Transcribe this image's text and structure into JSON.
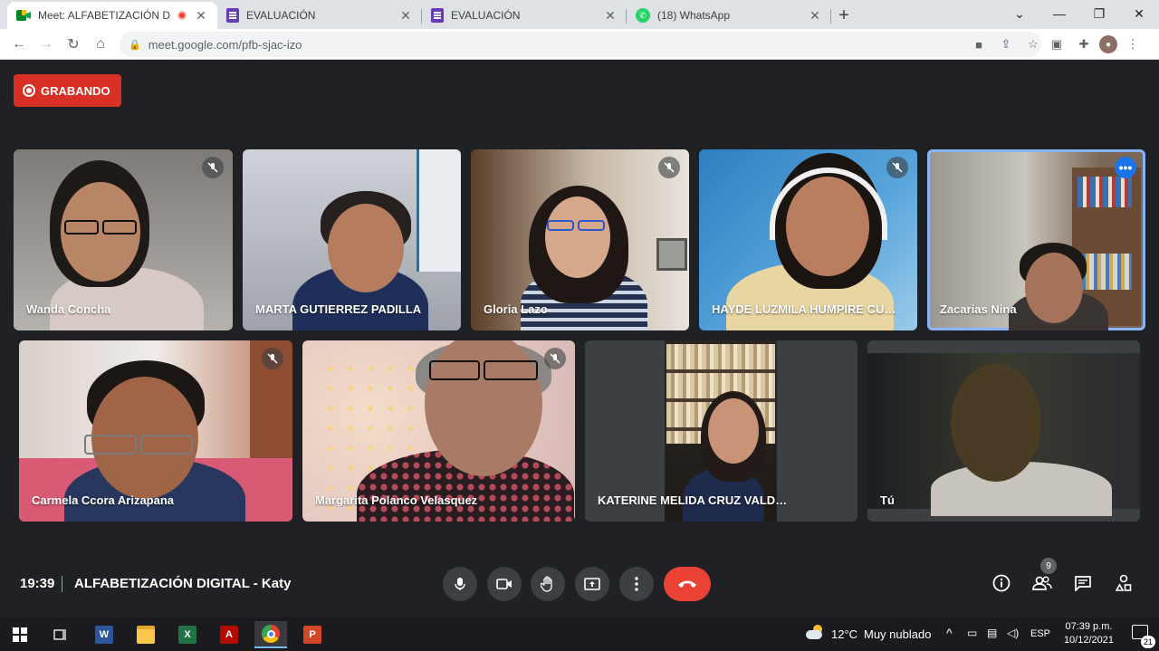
{
  "browser": {
    "tabs": [
      {
        "title": "Meet: ALFABETIZACIÓN DIGITAL",
        "icon": "google-meet-icon",
        "recording": true,
        "active": true
      },
      {
        "title": "EVALUACIÓN",
        "icon": "google-forms-icon",
        "active": false
      },
      {
        "title": "EVALUACIÓN",
        "icon": "google-forms-icon",
        "active": false
      },
      {
        "title": "(18) WhatsApp",
        "icon": "whatsapp-icon",
        "active": false
      }
    ],
    "url": "meet.google.com/pfb-sjac-izo",
    "new_tab": "+",
    "window_controls": [
      "⌄",
      "—",
      "❐",
      "✕"
    ]
  },
  "meet": {
    "recording_label": "GRABANDO",
    "participants": [
      {
        "name": "Wanda Concha",
        "muted": true
      },
      {
        "name": "MARTA GUTIERREZ PADILLA",
        "muted": false
      },
      {
        "name": "Gloria Lazo",
        "muted": true
      },
      {
        "name": "HAYDE LUZMILA HUMPIRE CUTI...",
        "muted": true
      },
      {
        "name": "Zacarias Nina",
        "muted": false,
        "pinned": true
      },
      {
        "name": "Carmela Ccora Arizapana",
        "muted": true
      },
      {
        "name": "Margarita Polanco Velasquez",
        "muted": true
      },
      {
        "name": "KATERINE MELIDA CRUZ VALDIVIA",
        "muted": false
      },
      {
        "name": "Tú",
        "muted": false
      }
    ],
    "time": "19:39",
    "meeting_title": "ALFABETIZACIÓN DIGITAL - Katy",
    "participant_count": "9",
    "controls": [
      "microphone-icon",
      "camera-icon",
      "raise-hand-icon",
      "present-screen-icon",
      "more-options-icon",
      "hang-up-icon"
    ],
    "side_controls": [
      "info-icon",
      "people-icon",
      "chat-icon",
      "activities-icon"
    ]
  },
  "taskbar": {
    "apps": [
      "windows-start-icon",
      "task-view-icon",
      "word-icon",
      "file-explorer-icon",
      "excel-icon",
      "acrobat-icon",
      "chrome-icon",
      "powerpoint-icon"
    ],
    "weather_temp": "12°C",
    "weather_desc": "Muy nublado",
    "language": "ESP",
    "time": "07:39 p.m.",
    "date": "10/12/2021",
    "notifications": "21"
  }
}
